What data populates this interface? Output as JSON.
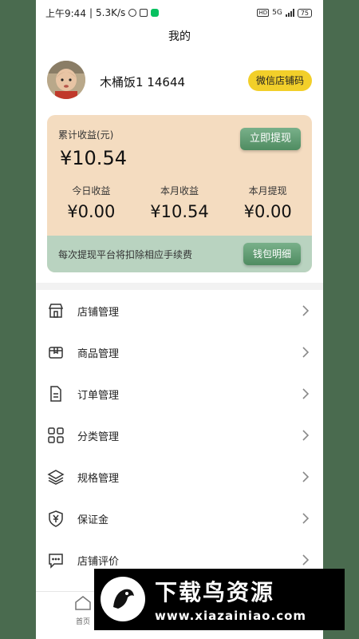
{
  "status_bar": {
    "time": "上午9:44",
    "speed": "5.3K/s",
    "network": "5G",
    "battery": "75"
  },
  "header": {
    "title": "我的"
  },
  "profile": {
    "username": "木桶饭1 14644",
    "shop_code_label": "微信店铺码"
  },
  "earnings": {
    "cumulative_label": "累计收益(元)",
    "cumulative_value": "¥10.54",
    "withdraw_label": "立即提现",
    "stats": [
      {
        "label": "今日收益",
        "value": "¥0.00"
      },
      {
        "label": "本月收益",
        "value": "¥10.54"
      },
      {
        "label": "本月提现",
        "value": "¥0.00"
      }
    ],
    "fee_note": "每次提现平台将扣除相应手续费",
    "wallet_label": "钱包明细"
  },
  "menu": [
    {
      "label": "店铺管理",
      "icon": "store-icon"
    },
    {
      "label": "商品管理",
      "icon": "box-icon"
    },
    {
      "label": "订单管理",
      "icon": "document-icon"
    },
    {
      "label": "分类管理",
      "icon": "grid-icon"
    },
    {
      "label": "规格管理",
      "icon": "layers-icon"
    },
    {
      "label": "保证金",
      "icon": "shield-yuan-icon"
    },
    {
      "label": "店铺评价",
      "icon": "chat-icon"
    }
  ],
  "bottom_nav": {
    "home_label": "首页"
  },
  "watermark": {
    "title": "下载鸟资源",
    "url": "www.xiazainiao.com"
  },
  "colors": {
    "accent_green": "#5a9a6c",
    "card_bg": "#f4dcc0",
    "yellow": "#f2cf2a"
  }
}
